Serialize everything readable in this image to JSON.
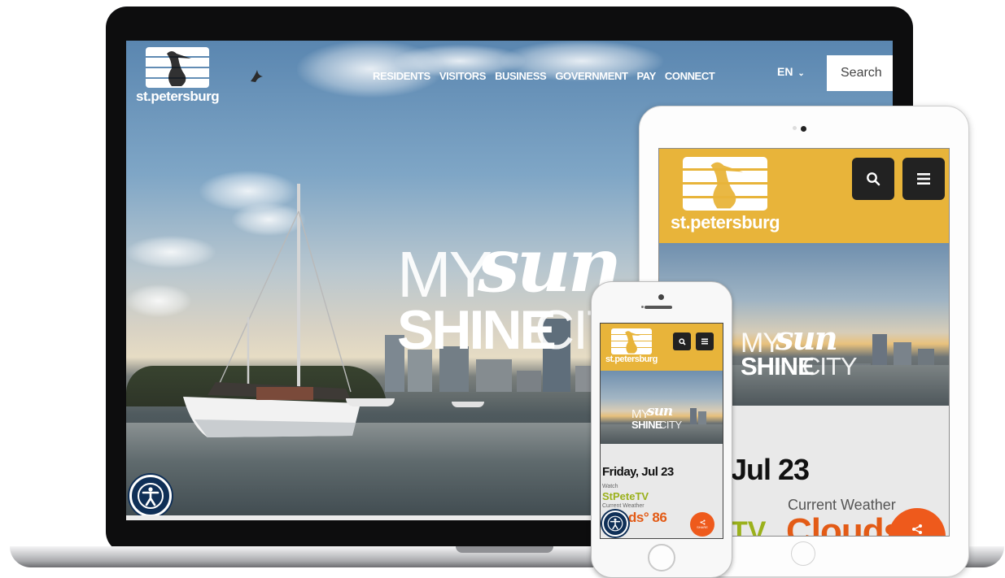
{
  "brand": {
    "wordmark": "st.petersburg",
    "accent_color": "#e8b43a",
    "weather_color": "#e35b16",
    "tv_color": "#9bb11c",
    "share_color": "#ee5a1c",
    "a11y_color": "#0f2f57"
  },
  "desktop": {
    "nav": [
      "RESIDENTS",
      "VISITORS",
      "BUSINESS",
      "GOVERNMENT",
      "PAY",
      "CONNECT"
    ],
    "language": "EN",
    "language_icon": "chevron-down-icon",
    "search_label": "Search",
    "hero": {
      "my": "MY",
      "sun": "sun",
      "shine": "SHINE",
      "city": "CITY"
    },
    "accessibility_icon": "accessibility-icon"
  },
  "tablet": {
    "search_icon": "search-icon",
    "menu_icon": "menu-icon",
    "hero": {
      "my": "MY",
      "sun": "sun",
      "shine": "SHINE",
      "city": "CITY"
    },
    "date": ", Jul 23",
    "weather_label": "Current Weather",
    "weather_value": "Clouds°",
    "tv_partial": "TV"
  },
  "phone": {
    "hero": {
      "my": "MY",
      "sun": "sun",
      "shine": "SHINE",
      "city": "CITY"
    },
    "date": "Friday, Jul 23",
    "watch_label": "Watch",
    "tv_label": "StPeteTV",
    "weather_label": "Current Weather",
    "weather_value": "ds° 86",
    "share_label": "SHARE"
  }
}
